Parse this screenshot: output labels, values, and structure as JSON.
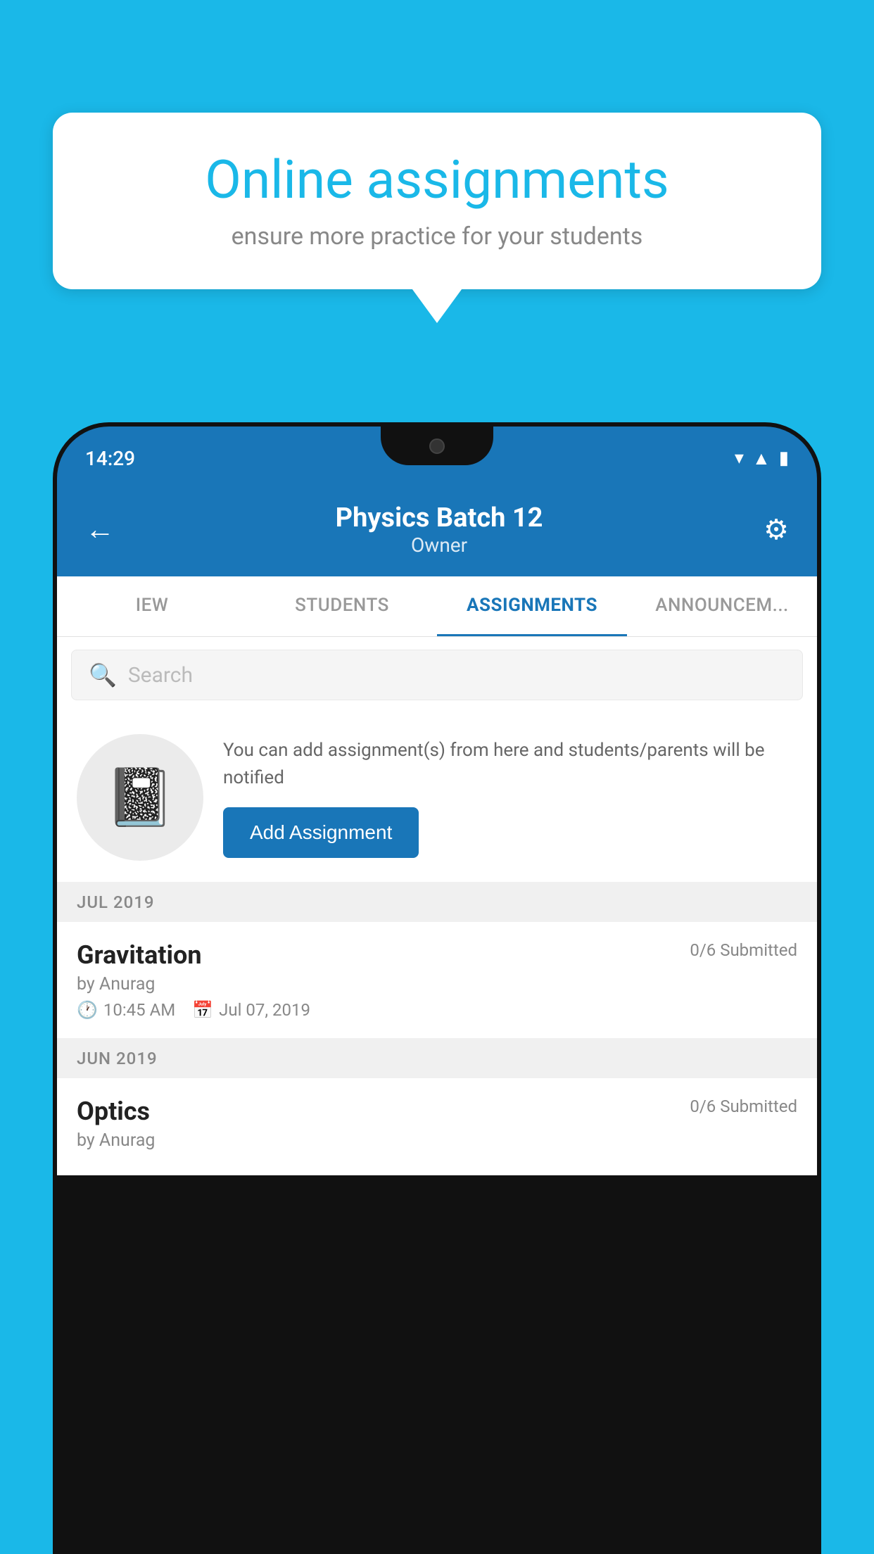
{
  "background_color": "#1ab8e8",
  "speech_bubble": {
    "title": "Online assignments",
    "subtitle": "ensure more practice for your students"
  },
  "status_bar": {
    "time": "14:29",
    "icons": [
      "wifi",
      "signal",
      "battery"
    ]
  },
  "header": {
    "title": "Physics Batch 12",
    "subtitle": "Owner",
    "back_label": "←",
    "gear_label": "⚙"
  },
  "tabs": [
    {
      "label": "IEW",
      "active": false
    },
    {
      "label": "STUDENTS",
      "active": false
    },
    {
      "label": "ASSIGNMENTS",
      "active": true
    },
    {
      "label": "ANNOUNCEM...",
      "active": false
    }
  ],
  "search": {
    "placeholder": "Search"
  },
  "promo": {
    "description": "You can add assignment(s) from here and students/parents will be notified",
    "button_label": "Add Assignment"
  },
  "sections": [
    {
      "month": "JUL 2019",
      "assignments": [
        {
          "name": "Gravitation",
          "submitted": "0/6 Submitted",
          "by": "by Anurag",
          "time": "10:45 AM",
          "date": "Jul 07, 2019"
        }
      ]
    },
    {
      "month": "JUN 2019",
      "assignments": [
        {
          "name": "Optics",
          "submitted": "0/6 Submitted",
          "by": "by Anurag",
          "time": "",
          "date": ""
        }
      ]
    }
  ]
}
